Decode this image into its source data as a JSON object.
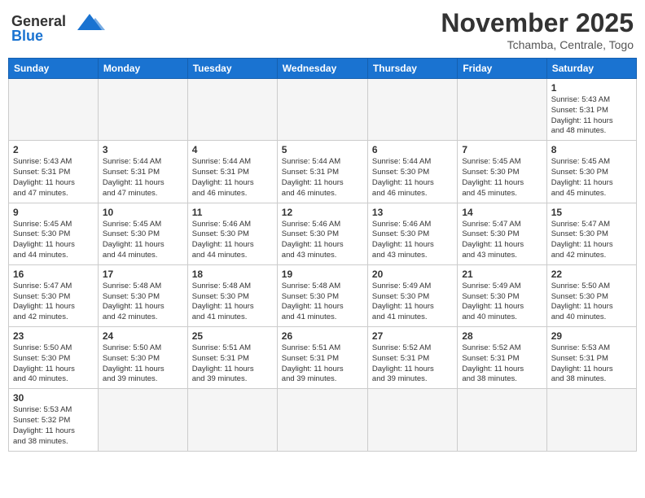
{
  "header": {
    "logo_general": "General",
    "logo_blue": "Blue",
    "month_title": "November 2025",
    "location": "Tchamba, Centrale, Togo"
  },
  "weekdays": [
    "Sunday",
    "Monday",
    "Tuesday",
    "Wednesday",
    "Thursday",
    "Friday",
    "Saturday"
  ],
  "weeks": [
    [
      {
        "day": "",
        "info": ""
      },
      {
        "day": "",
        "info": ""
      },
      {
        "day": "",
        "info": ""
      },
      {
        "day": "",
        "info": ""
      },
      {
        "day": "",
        "info": ""
      },
      {
        "day": "",
        "info": ""
      },
      {
        "day": "1",
        "info": "Sunrise: 5:43 AM\nSunset: 5:31 PM\nDaylight: 11 hours\nand 48 minutes."
      }
    ],
    [
      {
        "day": "2",
        "info": "Sunrise: 5:43 AM\nSunset: 5:31 PM\nDaylight: 11 hours\nand 47 minutes."
      },
      {
        "day": "3",
        "info": "Sunrise: 5:44 AM\nSunset: 5:31 PM\nDaylight: 11 hours\nand 47 minutes."
      },
      {
        "day": "4",
        "info": "Sunrise: 5:44 AM\nSunset: 5:31 PM\nDaylight: 11 hours\nand 46 minutes."
      },
      {
        "day": "5",
        "info": "Sunrise: 5:44 AM\nSunset: 5:31 PM\nDaylight: 11 hours\nand 46 minutes."
      },
      {
        "day": "6",
        "info": "Sunrise: 5:44 AM\nSunset: 5:30 PM\nDaylight: 11 hours\nand 46 minutes."
      },
      {
        "day": "7",
        "info": "Sunrise: 5:45 AM\nSunset: 5:30 PM\nDaylight: 11 hours\nand 45 minutes."
      },
      {
        "day": "8",
        "info": "Sunrise: 5:45 AM\nSunset: 5:30 PM\nDaylight: 11 hours\nand 45 minutes."
      }
    ],
    [
      {
        "day": "9",
        "info": "Sunrise: 5:45 AM\nSunset: 5:30 PM\nDaylight: 11 hours\nand 44 minutes."
      },
      {
        "day": "10",
        "info": "Sunrise: 5:45 AM\nSunset: 5:30 PM\nDaylight: 11 hours\nand 44 minutes."
      },
      {
        "day": "11",
        "info": "Sunrise: 5:46 AM\nSunset: 5:30 PM\nDaylight: 11 hours\nand 44 minutes."
      },
      {
        "day": "12",
        "info": "Sunrise: 5:46 AM\nSunset: 5:30 PM\nDaylight: 11 hours\nand 43 minutes."
      },
      {
        "day": "13",
        "info": "Sunrise: 5:46 AM\nSunset: 5:30 PM\nDaylight: 11 hours\nand 43 minutes."
      },
      {
        "day": "14",
        "info": "Sunrise: 5:47 AM\nSunset: 5:30 PM\nDaylight: 11 hours\nand 43 minutes."
      },
      {
        "day": "15",
        "info": "Sunrise: 5:47 AM\nSunset: 5:30 PM\nDaylight: 11 hours\nand 42 minutes."
      }
    ],
    [
      {
        "day": "16",
        "info": "Sunrise: 5:47 AM\nSunset: 5:30 PM\nDaylight: 11 hours\nand 42 minutes."
      },
      {
        "day": "17",
        "info": "Sunrise: 5:48 AM\nSunset: 5:30 PM\nDaylight: 11 hours\nand 42 minutes."
      },
      {
        "day": "18",
        "info": "Sunrise: 5:48 AM\nSunset: 5:30 PM\nDaylight: 11 hours\nand 41 minutes."
      },
      {
        "day": "19",
        "info": "Sunrise: 5:48 AM\nSunset: 5:30 PM\nDaylight: 11 hours\nand 41 minutes."
      },
      {
        "day": "20",
        "info": "Sunrise: 5:49 AM\nSunset: 5:30 PM\nDaylight: 11 hours\nand 41 minutes."
      },
      {
        "day": "21",
        "info": "Sunrise: 5:49 AM\nSunset: 5:30 PM\nDaylight: 11 hours\nand 40 minutes."
      },
      {
        "day": "22",
        "info": "Sunrise: 5:50 AM\nSunset: 5:30 PM\nDaylight: 11 hours\nand 40 minutes."
      }
    ],
    [
      {
        "day": "23",
        "info": "Sunrise: 5:50 AM\nSunset: 5:30 PM\nDaylight: 11 hours\nand 40 minutes."
      },
      {
        "day": "24",
        "info": "Sunrise: 5:50 AM\nSunset: 5:30 PM\nDaylight: 11 hours\nand 39 minutes."
      },
      {
        "day": "25",
        "info": "Sunrise: 5:51 AM\nSunset: 5:31 PM\nDaylight: 11 hours\nand 39 minutes."
      },
      {
        "day": "26",
        "info": "Sunrise: 5:51 AM\nSunset: 5:31 PM\nDaylight: 11 hours\nand 39 minutes."
      },
      {
        "day": "27",
        "info": "Sunrise: 5:52 AM\nSunset: 5:31 PM\nDaylight: 11 hours\nand 39 minutes."
      },
      {
        "day": "28",
        "info": "Sunrise: 5:52 AM\nSunset: 5:31 PM\nDaylight: 11 hours\nand 38 minutes."
      },
      {
        "day": "29",
        "info": "Sunrise: 5:53 AM\nSunset: 5:31 PM\nDaylight: 11 hours\nand 38 minutes."
      }
    ],
    [
      {
        "day": "30",
        "info": "Sunrise: 5:53 AM\nSunset: 5:32 PM\nDaylight: 11 hours\nand 38 minutes."
      },
      {
        "day": "",
        "info": ""
      },
      {
        "day": "",
        "info": ""
      },
      {
        "day": "",
        "info": ""
      },
      {
        "day": "",
        "info": ""
      },
      {
        "day": "",
        "info": ""
      },
      {
        "day": "",
        "info": ""
      }
    ]
  ]
}
